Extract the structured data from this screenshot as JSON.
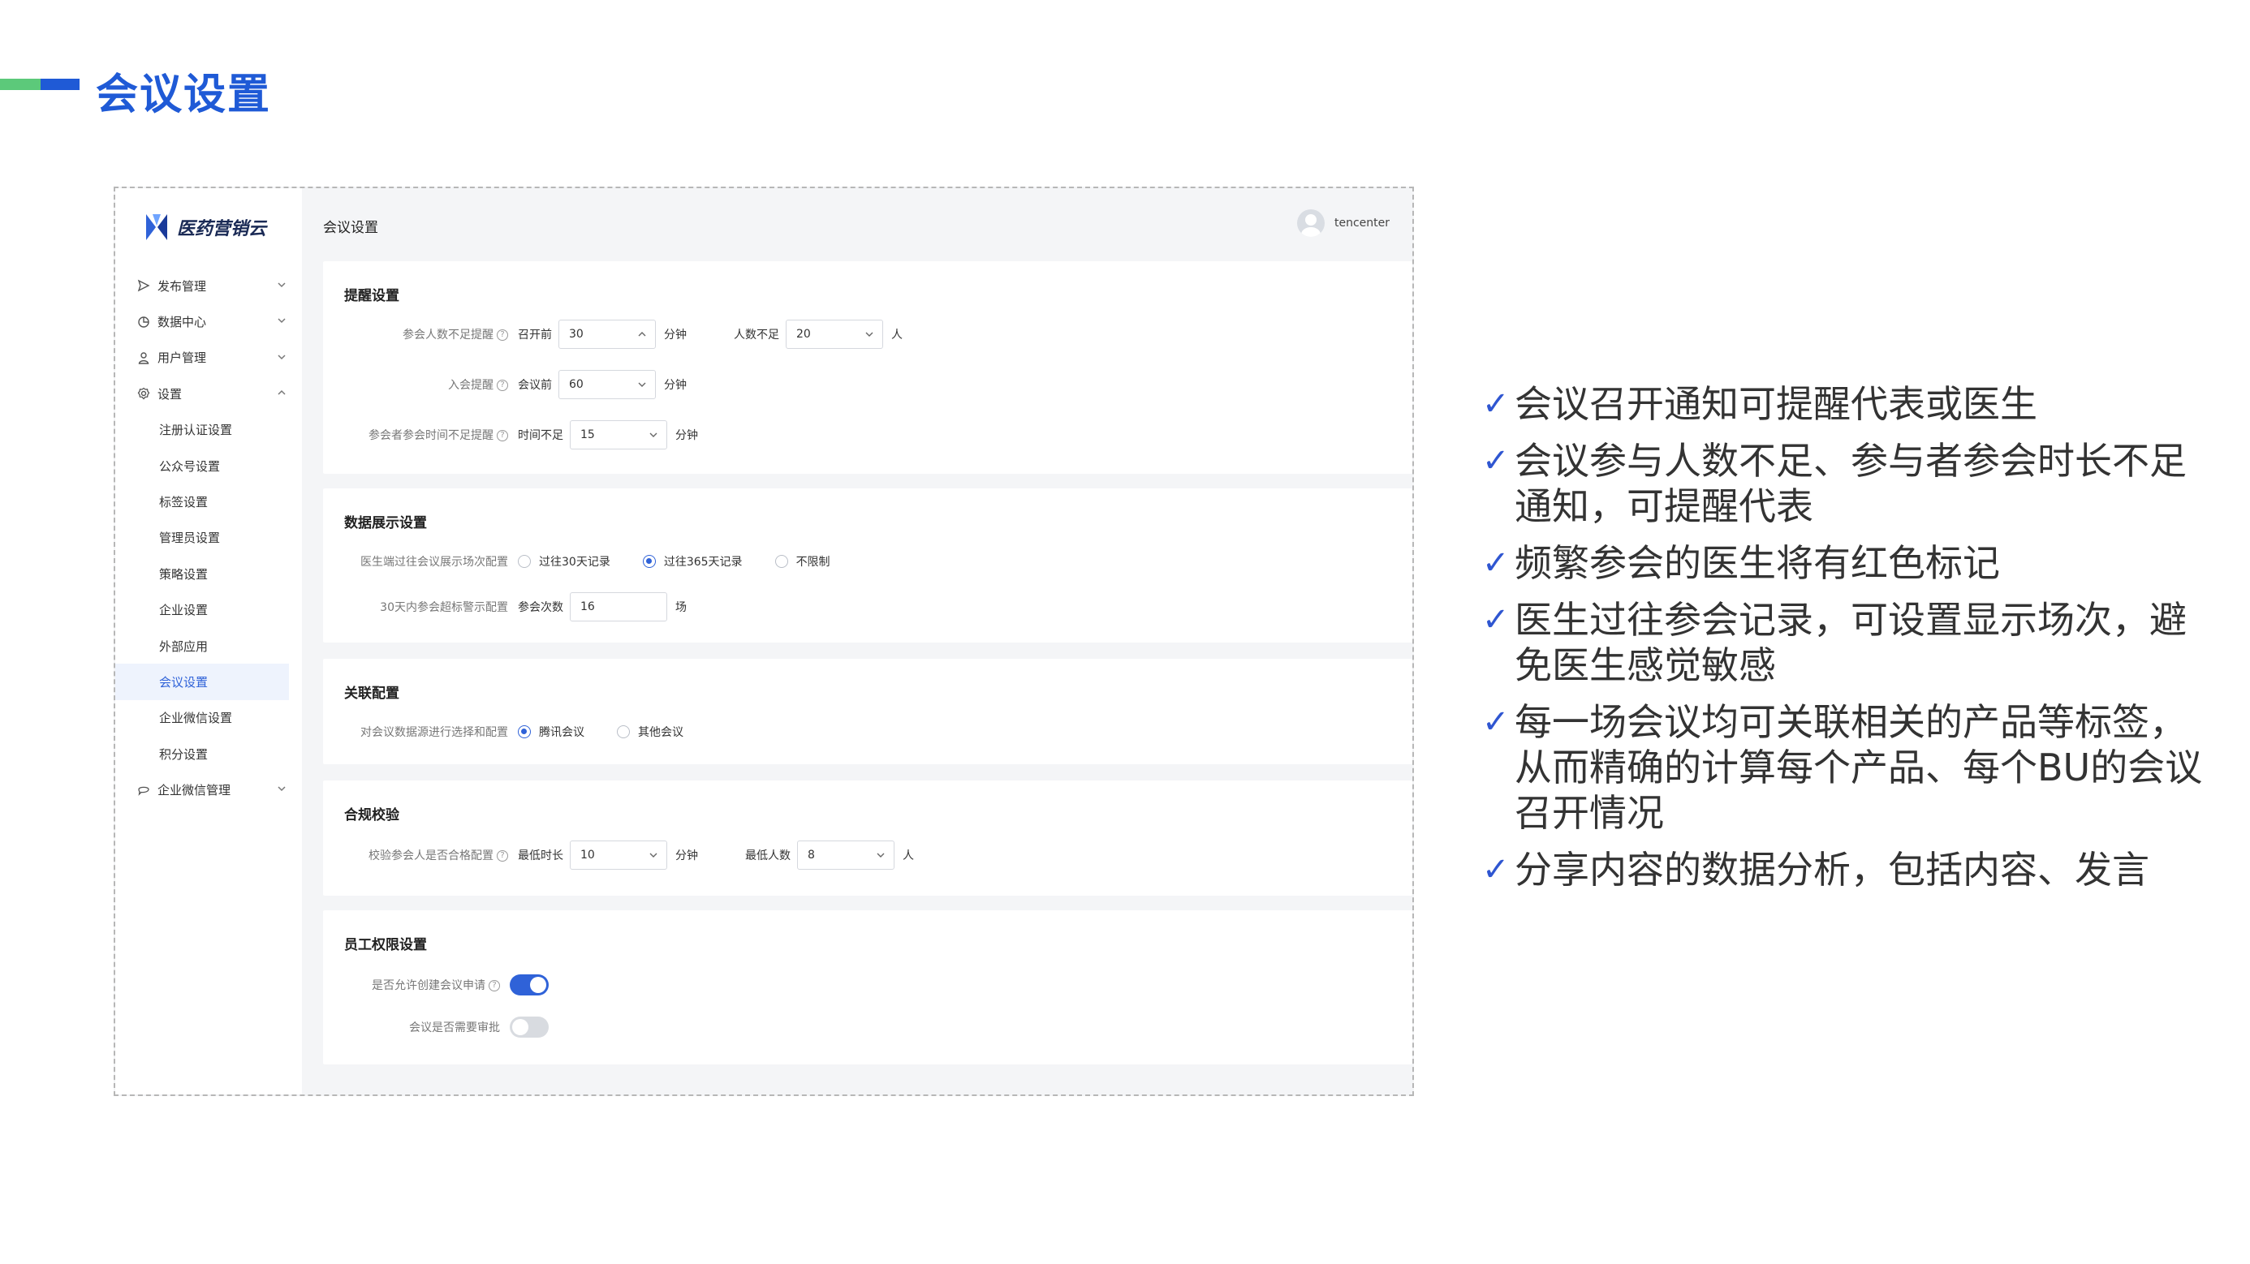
{
  "slide": {
    "title": "会议设置"
  },
  "app": {
    "logo_text": "医药营销云",
    "page_title": "会议设置",
    "username": "tencenter"
  },
  "nav": {
    "items": [
      {
        "label": "发布管理"
      },
      {
        "label": "数据中心"
      },
      {
        "label": "用户管理"
      },
      {
        "label": "设置"
      }
    ],
    "sub_items": [
      {
        "label": "注册认证设置"
      },
      {
        "label": "公众号设置"
      },
      {
        "label": "标签设置"
      },
      {
        "label": "管理员设置"
      },
      {
        "label": "策略设置"
      },
      {
        "label": "企业设置"
      },
      {
        "label": "外部应用"
      },
      {
        "label": "会议设置"
      },
      {
        "label": "企业微信设置"
      },
      {
        "label": "积分设置"
      }
    ],
    "last_item": {
      "label": "企业微信管理"
    },
    "active": "会议设置"
  },
  "reminder": {
    "title": "提醒设置",
    "row1": {
      "label": "参会人数不足提醒",
      "prefix": "召开前",
      "value": "30",
      "unit": "分钟",
      "prefix2": "人数不足",
      "value2": "20",
      "unit2": "人"
    },
    "row2": {
      "label": "入会提醒",
      "prefix": "会议前",
      "value": "60",
      "unit": "分钟"
    },
    "row3": {
      "label": "参会者参会时间不足提醒",
      "prefix": "时间不足",
      "value": "15",
      "unit": "分钟"
    }
  },
  "display": {
    "title": "数据展示设置",
    "row1": {
      "label": "医生端过往会议展示场次配置",
      "options": [
        "过往30天记录",
        "过往365天记录",
        "不限制"
      ],
      "selected": "过往365天记录"
    },
    "row2": {
      "label": "30天内参会超标警示配置",
      "prefix": "参会次数",
      "value": "16",
      "unit": "场"
    }
  },
  "link": {
    "title": "关联配置",
    "row1": {
      "label": "对会议数据源进行选择和配置",
      "options": [
        "腾讯会议",
        "其他会议"
      ],
      "selected": "腾讯会议"
    }
  },
  "compliance": {
    "title": "合规校验",
    "row1": {
      "label": "校验参会人是否合格配置",
      "prefix": "最低时长",
      "value": "10",
      "unit": "分钟",
      "prefix2": "最低人数",
      "value2": "8",
      "unit2": "人"
    }
  },
  "permission": {
    "title": "员工权限设置",
    "row1": {
      "label": "是否允许创建会议申请",
      "enabled": true
    },
    "row2": {
      "label": "会议是否需要审批",
      "enabled": false
    }
  },
  "bullets": [
    "会议召开通知可提醒代表或医生",
    "会议参与人数不足、参与者参会时长不足通知，可提醒代表",
    "频繁参会的医生将有红色标记",
    "医生过往参会记录，可设置显示场次，避免医生感觉敏感",
    "每一场会议均可关联相关的产品等标签，从而精确的计算每个产品、每个BU的会议召开情况",
    "分享内容的数据分析，包括内容、发言"
  ],
  "colors": {
    "brand_blue": "#1f5ad6",
    "accent_green": "#5cc97a",
    "primary": "#2f62d8"
  }
}
